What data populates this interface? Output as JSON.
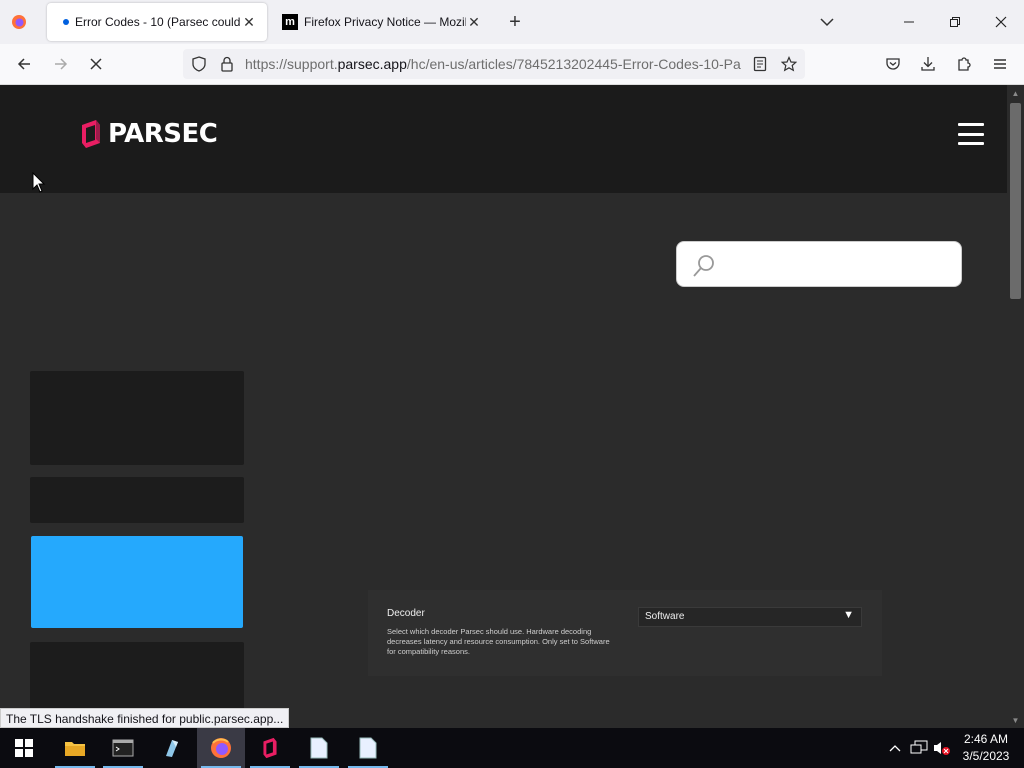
{
  "browser": {
    "tabs": [
      {
        "title": "Error Codes - 10 (Parsec couldn't",
        "active": true,
        "loading": true
      },
      {
        "title": "Firefox Privacy Notice — Mozilla",
        "active": false
      }
    ],
    "url_prefix": "https://support.",
    "url_domain": "parsec.app",
    "url_suffix": "/hc/en-us/articles/7845213202445-Error-Codes-10-Pa"
  },
  "site": {
    "logo_text": "PARSEC",
    "accent_color": "#e91e63",
    "highlight_color": "#25a9fd"
  },
  "settings_panel": {
    "title": "Decoder",
    "description": "Select which decoder Parsec should use. Hardware decoding decreases latency and resource consumption. Only set to Software for compatibility reasons.",
    "select_value": "Software"
  },
  "status": {
    "text": "The TLS handshake finished for public.parsec.app..."
  },
  "taskbar": {
    "time": "2:46 AM",
    "date": "3/5/2023"
  }
}
